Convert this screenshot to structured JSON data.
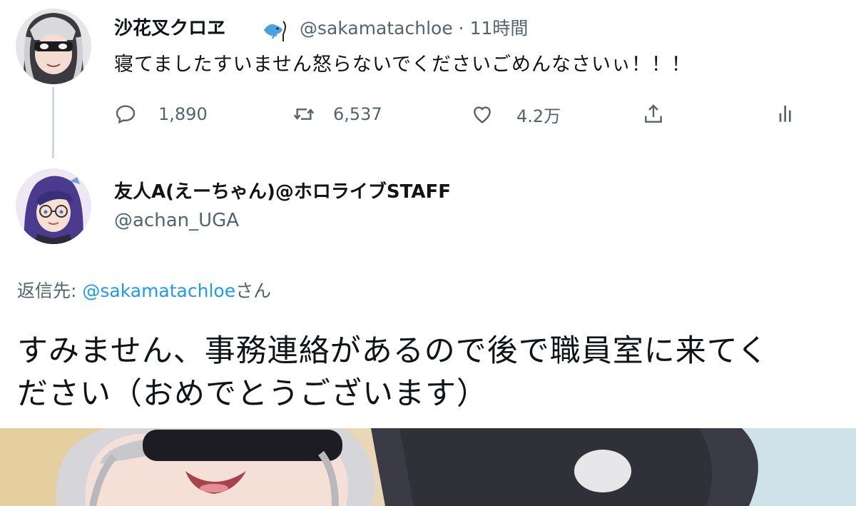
{
  "original_tweet": {
    "author_name": "沙花叉クロヱ",
    "handle": "@sakamatachloe",
    "separator": "·",
    "time": "11時間",
    "text": "寝てましたすいません怒らないでくださいごめんなさいぃ！！！",
    "actions": {
      "replies": "1,890",
      "retweets": "6,537",
      "likes": "4.2万"
    },
    "icons": {
      "reply": "reply-icon",
      "retweet": "retweet-icon",
      "like": "heart-icon",
      "share": "share-icon",
      "analytics": "analytics-icon",
      "badge": "fish-badge-icon"
    }
  },
  "reply_tweet": {
    "author_name": "友人A(えーちゃん)@ホロライブSTAFF",
    "handle": "@achan_UGA",
    "reply_to_prefix": "返信先: ",
    "reply_to_handle": "@sakamatachloe",
    "reply_to_suffix": "さん",
    "text_line1": "すみません、事務連絡があるので後で職員室に来てく",
    "text_line2": "ださい（おめでとうございます）"
  },
  "colors": {
    "text": "#0f1419",
    "muted": "#536471",
    "link": "#1d9bf0",
    "thread_line": "#cfd9de",
    "background": "#ffffff"
  }
}
